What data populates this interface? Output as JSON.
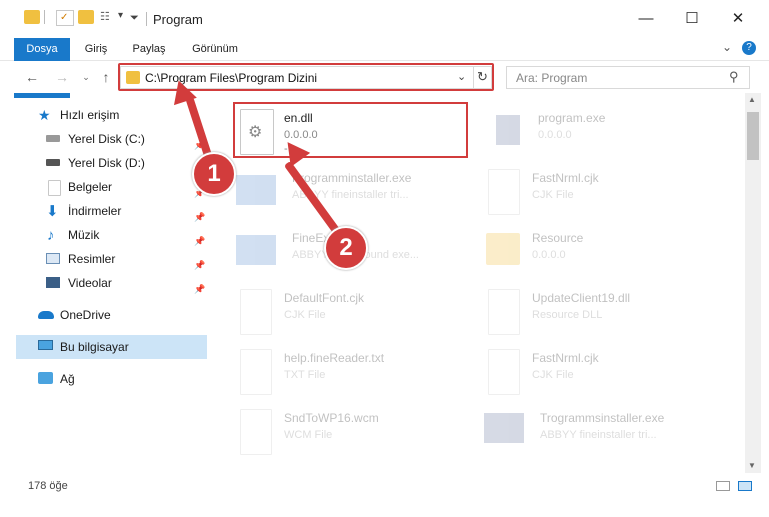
{
  "window": {
    "title": "Program",
    "minimize": "—",
    "maximize": "☐",
    "close": "✕"
  },
  "ribbon": {
    "tabs": [
      "Dosya",
      "Giriş",
      "Paylaş",
      "Görünüm"
    ],
    "expand": "⌄",
    "help": "?"
  },
  "address": {
    "path": "C:\\Program Files\\Program Dizini",
    "search_placeholder": "Ara: Program"
  },
  "sidebar": {
    "quick_access": "Hızlı erişim",
    "items": [
      {
        "label": "Yerel Disk (C:)",
        "pinned": true
      },
      {
        "label": "Yerel Disk (D:)",
        "pinned": true
      },
      {
        "label": "Belgeler",
        "pinned": true
      },
      {
        "label": "İndirmeler",
        "pinned": true
      },
      {
        "label": "Müzik",
        "pinned": true
      },
      {
        "label": "Resimler",
        "pinned": true
      },
      {
        "label": "Videolar",
        "pinned": true
      }
    ],
    "onedrive": "OneDrive",
    "this_pc": "Bu bilgisayar",
    "network": "Ağ"
  },
  "files": {
    "highlighted": {
      "name": "en.dll",
      "version": "0.0.0.0",
      "extra": "-"
    },
    "list": [
      {
        "name": "program.exe",
        "desc": "0.0.0.0"
      },
      {
        "name": "Programminstaller.exe",
        "desc": "ABBYY fineinstaller tri..."
      },
      {
        "name": "FastNrml.cjk",
        "desc": "CJK File"
      },
      {
        "name": "FineExe.exe",
        "desc": "ABBYY background exe..."
      },
      {
        "name": "Resource",
        "desc": "0.0.0.0"
      },
      {
        "name": "DefaultFont.cjk",
        "desc": "CJK File"
      },
      {
        "name": "UpdateClient19.dll",
        "desc": "Resource DLL"
      },
      {
        "name": "help.fineReader.txt",
        "desc": "TXT File"
      },
      {
        "name": "FastNrml.cjk",
        "desc": "CJK File"
      },
      {
        "name": "SndToWP16.wcm",
        "desc": "WCM File"
      },
      {
        "name": "Trogrammsinstaller.exe",
        "desc": "ABBYY fineinstaller tri..."
      }
    ]
  },
  "status": {
    "count": "178 öğe"
  },
  "annotations": {
    "badge1": "1",
    "badge2": "2"
  }
}
